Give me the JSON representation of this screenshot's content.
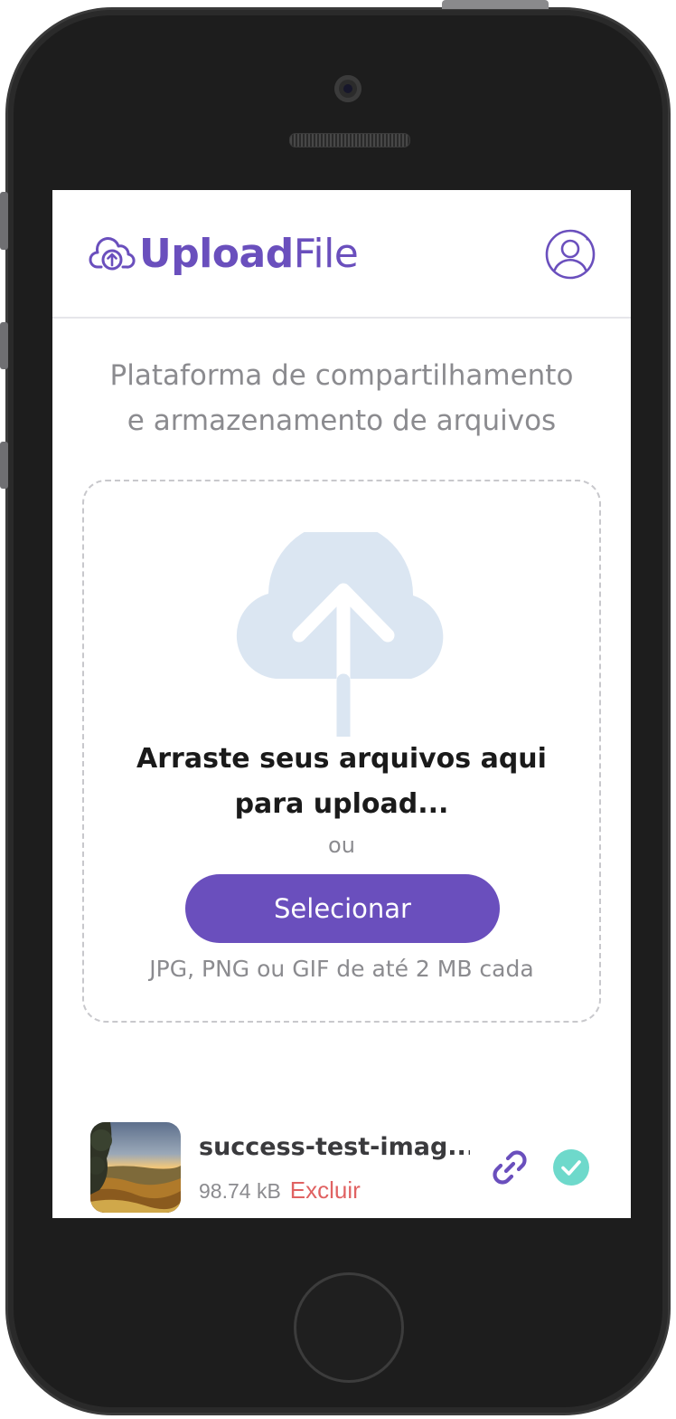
{
  "app": {
    "logo_bold": "Upload",
    "logo_light": "File",
    "logo_icon": "cloud-upload-icon",
    "profile_icon": "user-circle-icon",
    "brand_color": "#6a4fbd"
  },
  "main": {
    "tagline_line1": "Plataforma de compartilhamento",
    "tagline_line2": "e armazenamento de arquivos"
  },
  "dropzone": {
    "icon": "cloud-upload-large-icon",
    "title_line1": "Arraste seus arquivos aqui",
    "title_line2": "para upload...",
    "or_text": "ou",
    "select_label": "Selecionar",
    "hint": "JPG, PNG ou GIF de até 2 MB cada"
  },
  "files": [
    {
      "name": "success-test-imag...",
      "size": "98.74 kB",
      "delete_label": "Excluir",
      "link_icon": "link-icon",
      "status_icon": "check-circle-icon",
      "status_color": "#6ed9cb"
    }
  ]
}
